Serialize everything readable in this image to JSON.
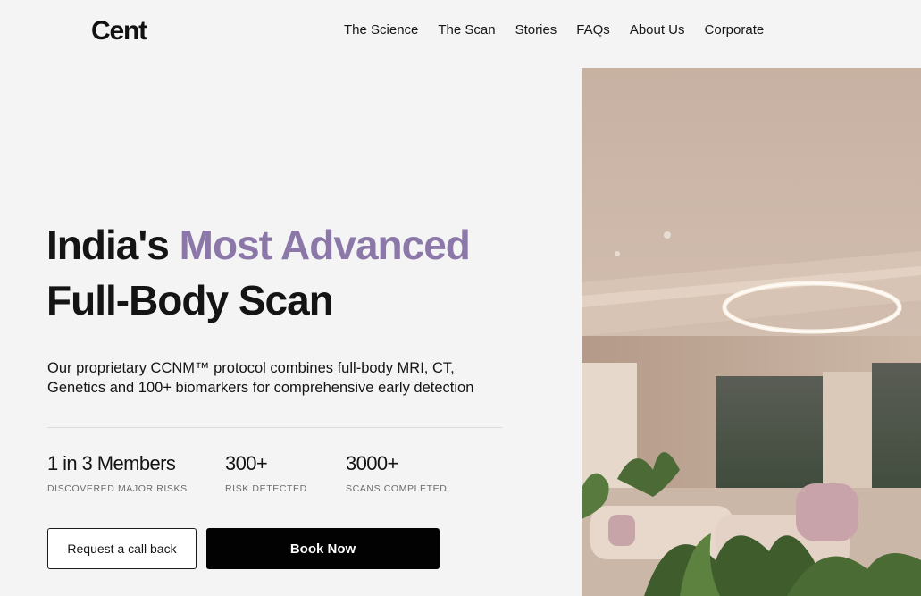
{
  "header": {
    "logo": "Cent",
    "nav": [
      "The Science",
      "The Scan",
      "Stories",
      "FAQs",
      "About Us",
      "Corporate"
    ]
  },
  "hero": {
    "headline_part1": "India's ",
    "headline_accent": "Most Advanced",
    "headline_line2": "Full-Body Scan",
    "description_line1": "Our proprietary CCNM™ protocol combines full-body MRI, CT,",
    "description_line2": "Genetics and 100+ biomarkers for comprehensive early detection",
    "stats": [
      {
        "value": "1 in 3 Members",
        "label": "DISCOVERED MAJOR RISKS"
      },
      {
        "value": "300+",
        "label": "RISK DETECTED"
      },
      {
        "value": "3000+",
        "label": "SCANS COMPLETED"
      }
    ],
    "cta_secondary": "Request a call back",
    "cta_primary": "Book Now"
  },
  "colors": {
    "accent": "#8b78a9",
    "background": "#f4f4f4",
    "primary_button": "#020202"
  },
  "image": {
    "subject": "clinic-lounge-photo"
  }
}
